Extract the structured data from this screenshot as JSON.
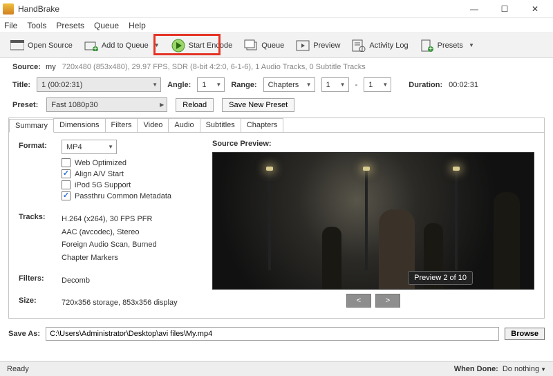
{
  "window": {
    "title": "HandBrake"
  },
  "window_controls": {
    "min": "—",
    "max": "☐",
    "close": "✕"
  },
  "menu": {
    "file": "File",
    "tools": "Tools",
    "presets": "Presets",
    "queue": "Queue",
    "help": "Help"
  },
  "toolbar": {
    "open_source": "Open Source",
    "add_queue": "Add to Queue",
    "start_encode": "Start Encode",
    "queue": "Queue",
    "preview": "Preview",
    "activity_log": "Activity Log",
    "presets": "Presets"
  },
  "source": {
    "label": "Source:",
    "name": "my",
    "details": "720x480 (853x480), 29.97 FPS, SDR (8-bit 4:2:0, 6-1-6), 1 Audio Tracks, 0 Subtitle Tracks"
  },
  "title": {
    "label": "Title:",
    "value": "1 (00:02:31)",
    "angle_label": "Angle:",
    "angle_value": "1",
    "range_label": "Range:",
    "range_value": "Chapters",
    "range_from": "1",
    "range_sep": "-",
    "range_to": "1",
    "duration_label": "Duration:",
    "duration_value": "00:02:31"
  },
  "preset": {
    "label": "Preset:",
    "value": "Fast 1080p30",
    "reload": "Reload",
    "save": "Save New Preset"
  },
  "tabs": {
    "summary": "Summary",
    "dimensions": "Dimensions",
    "filters": "Filters",
    "video": "Video",
    "audio": "Audio",
    "subtitles": "Subtitles",
    "chapters": "Chapters"
  },
  "summary": {
    "format_label": "Format:",
    "format_value": "MP4",
    "web_opt": "Web Optimized",
    "align_av": "Align A/V Start",
    "ipod": "iPod 5G Support",
    "passthru": "Passthru Common Metadata",
    "tracks_label": "Tracks:",
    "track0": "H.264 (x264), 30 FPS PFR",
    "track1": "AAC (avcodec), Stereo",
    "track2": "Foreign Audio Scan, Burned",
    "track3": "Chapter Markers",
    "filters_label": "Filters:",
    "filters_value": "Decomb",
    "size_label": "Size:",
    "size_value": "720x356 storage, 853x356 display"
  },
  "preview": {
    "label": "Source Preview:",
    "badge": "Preview 2 of 10",
    "prev": "<",
    "next": ">"
  },
  "saveas": {
    "label": "Save As:",
    "path": "C:\\Users\\Administrator\\Desktop\\avi files\\My.mp4",
    "browse": "Browse"
  },
  "status": {
    "ready": "Ready",
    "when_done_label": "When Done:",
    "when_done_value": "Do nothing"
  }
}
